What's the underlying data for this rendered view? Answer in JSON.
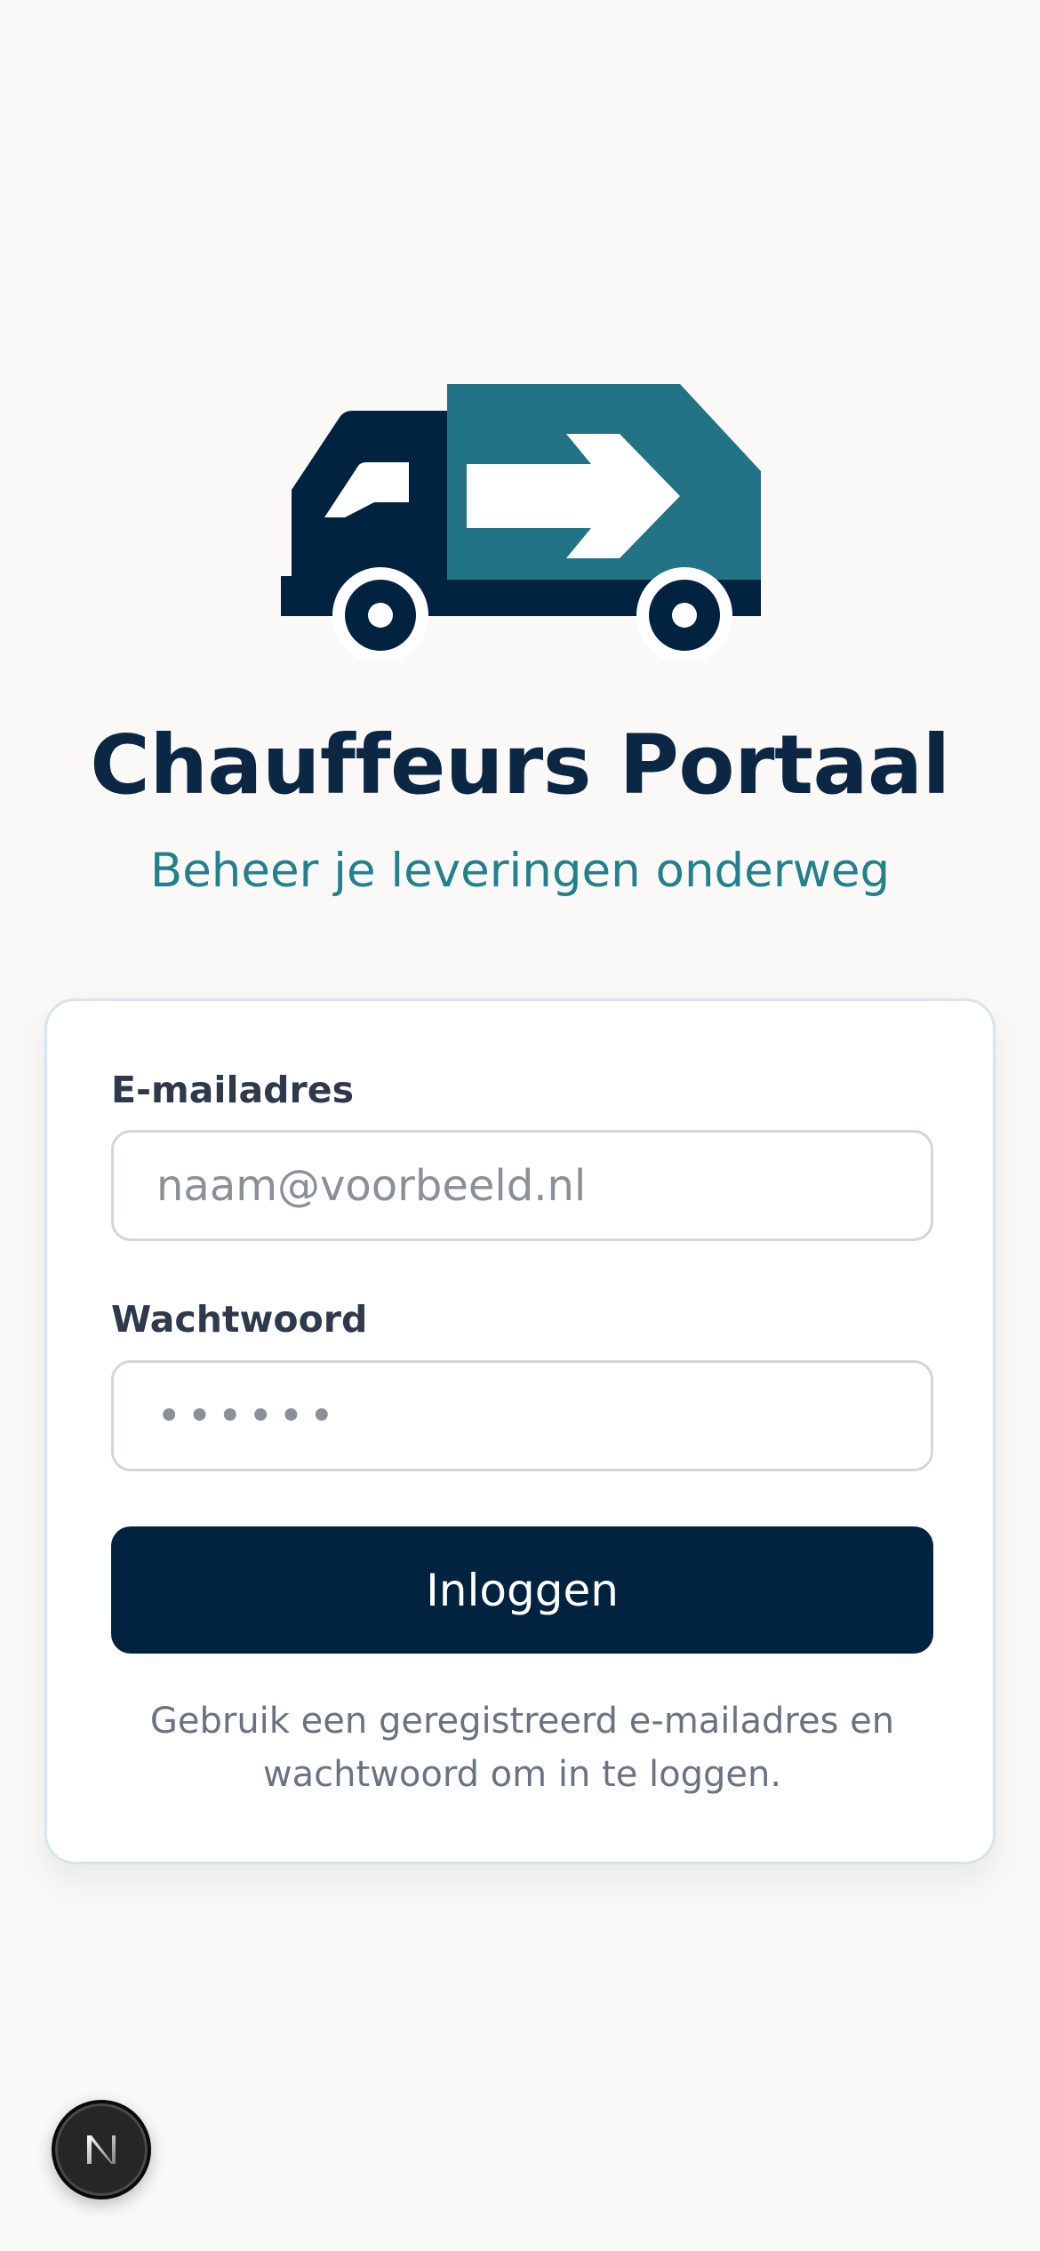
{
  "header": {
    "title": "Chauffeurs Portaal",
    "subtitle": "Beheer je leveringen onderweg",
    "logo_icon": "delivery-truck-icon"
  },
  "form": {
    "email_label": "E-mailadres",
    "email_placeholder": "naam@voorbeeld.nl",
    "password_label": "Wachtwoord",
    "password_placeholder": "••••••",
    "submit_label": "Inloggen",
    "hint": "Gebruik een geregistreerd e-mailadres en wachtwoord om in te loggen."
  },
  "colors": {
    "background": "#fbf9f8",
    "primary_dark": "#02233f",
    "accent_teal": "#23818c",
    "truck_cargo": "#217385"
  },
  "dev_badge": {
    "icon": "nextjs-logo-icon"
  }
}
